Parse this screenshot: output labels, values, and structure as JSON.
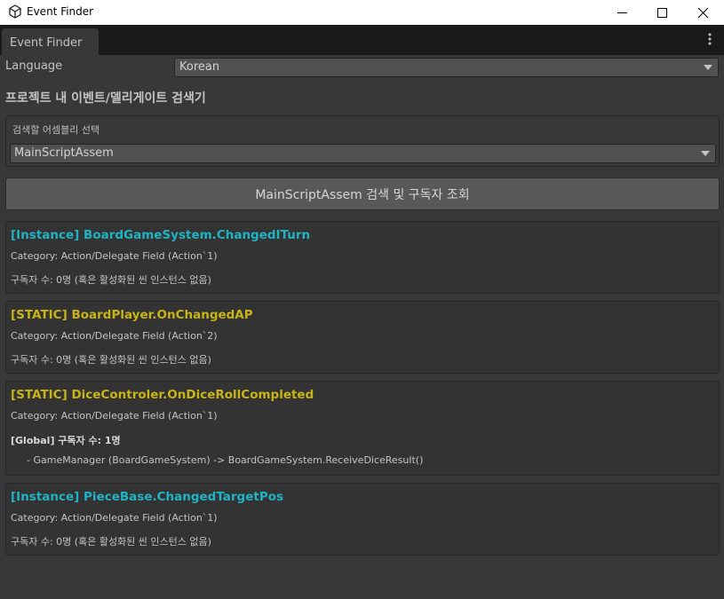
{
  "window": {
    "title": "Event Finder",
    "icon": "unity-icon",
    "controls": [
      "minimize-icon",
      "maximize-icon",
      "close-icon"
    ]
  },
  "tab": {
    "label": "Event Finder"
  },
  "language": {
    "label": "Language",
    "value": "Korean"
  },
  "page_title": "프로젝트 내 이벤트/델리게이트 검색기",
  "assembly": {
    "label": "검색할 어셈블리 선택",
    "value": "MainScriptAssem"
  },
  "search_button": "MainScriptAssem 검색 및 구독자 조회",
  "colors": {
    "instance": "#1fb4c4",
    "static": "#c8b415",
    "background": "#383838"
  },
  "events": [
    {
      "title": "[Instance] BoardGameSystem.ChangedITurn",
      "kind": "instance",
      "category": "Category: Action/Delegate Field (Action`1)",
      "subscribers": "구독자 수: 0명 (혹은 활성화된 씬 인스턴스 없음)"
    },
    {
      "title": "[STATIC] BoardPlayer.OnChangedAP",
      "kind": "static",
      "category": "Category: Action/Delegate Field (Action`2)",
      "subscribers": "구독자 수: 0명 (혹은 활성화된 씬 인스턴스 없음)"
    },
    {
      "title": "[STATIC] DiceControler.OnDiceRollCompleted",
      "kind": "static",
      "category": "Category: Action/Delegate Field (Action`1)",
      "global_subscribers": "[Global] 구독자 수: 1명",
      "entries": [
        "- GameManager (BoardGameSystem) -> BoardGameSystem.ReceiveDiceResult()"
      ]
    },
    {
      "title": "[Instance] PieceBase.ChangedTargetPos",
      "kind": "instance",
      "category": "Category: Action/Delegate Field (Action`1)",
      "subscribers": "구독자 수: 0명 (혹은 활성화된 씬 인스턴스 없음)"
    }
  ]
}
